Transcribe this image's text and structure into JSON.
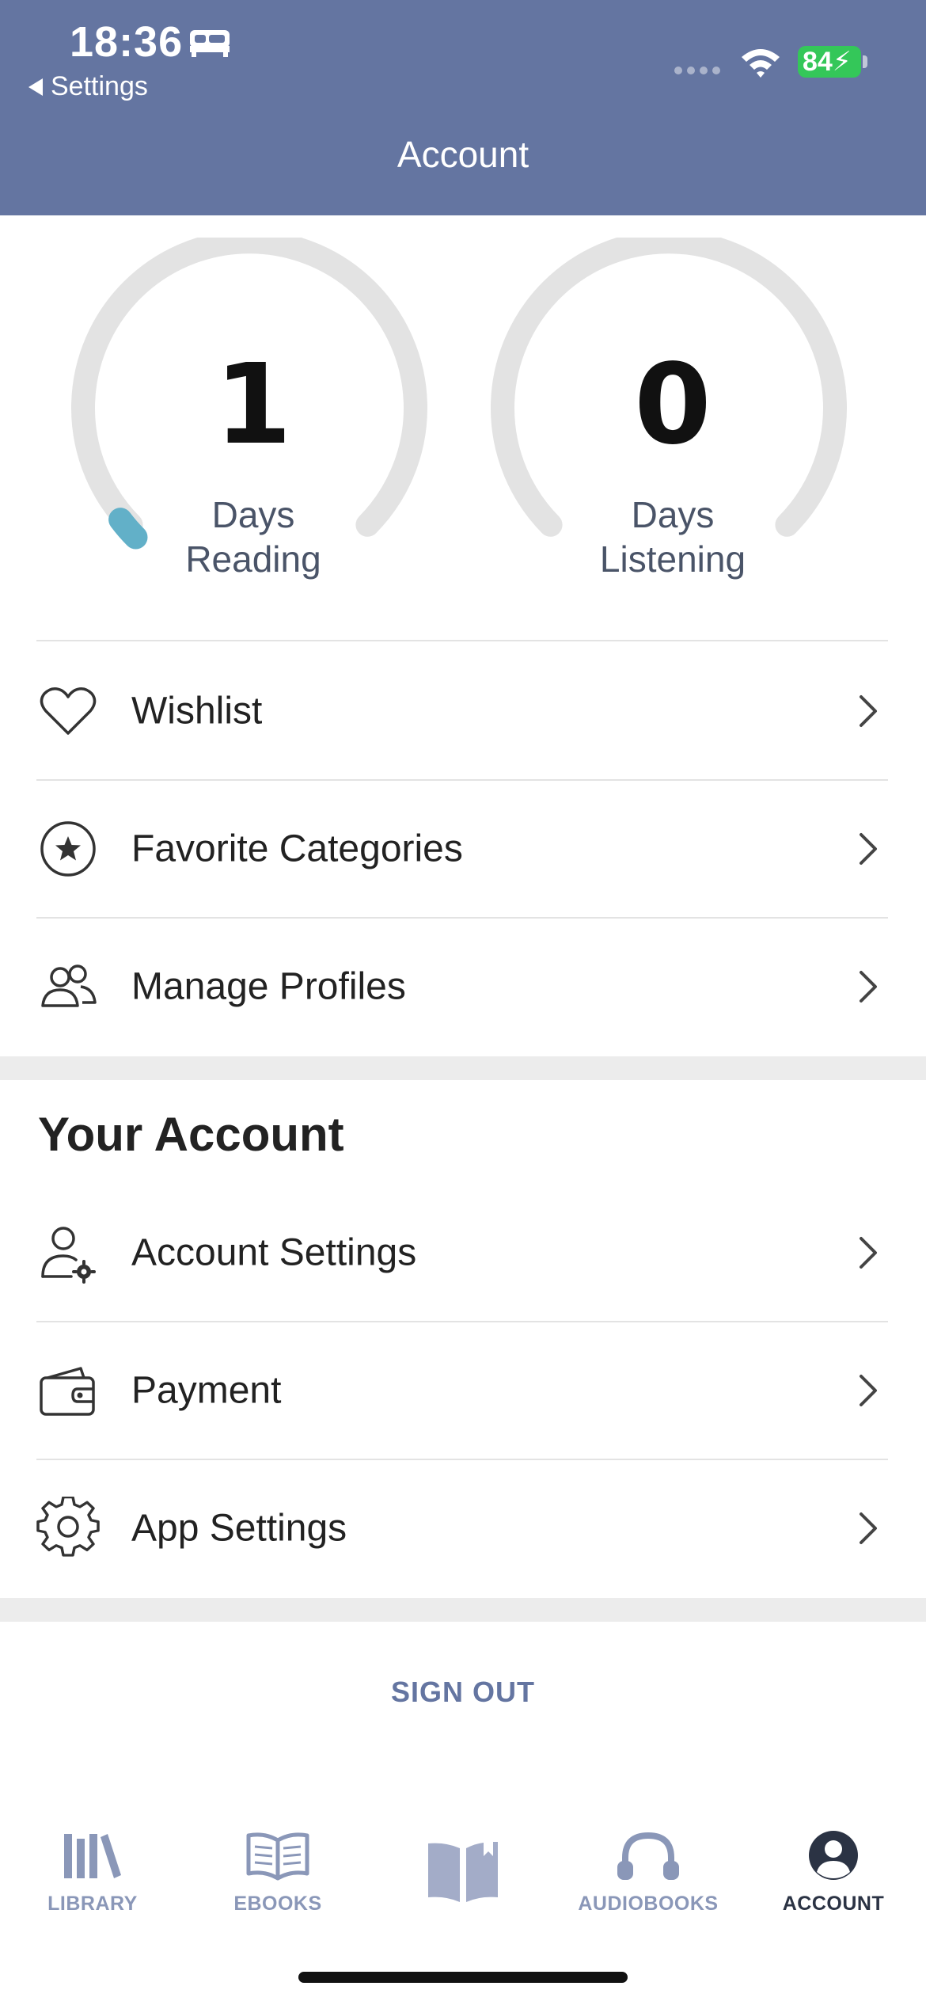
{
  "status_bar": {
    "time": "18:36",
    "back_label": "Settings",
    "battery": "84"
  },
  "header": {
    "title": "Account"
  },
  "stats": [
    {
      "value": "1",
      "label_line1": "Days",
      "label_line2": "Reading",
      "progress": 0.03
    },
    {
      "value": "0",
      "label_line1": "Days",
      "label_line2": "Listening",
      "progress": 0
    }
  ],
  "colors": {
    "accent": "#6475a1",
    "progress": "#62b0c8",
    "track": "#e3e3e3"
  },
  "quick_links": [
    {
      "label": "Wishlist",
      "icon": "heart-icon"
    },
    {
      "label": "Favorite Categories",
      "icon": "star-circle-icon"
    },
    {
      "label": "Manage Profiles",
      "icon": "users-icon"
    }
  ],
  "your_account": {
    "title": "Your Account",
    "items": [
      {
        "label": "Account Settings",
        "icon": "user-gear-icon"
      },
      {
        "label": "Payment",
        "icon": "wallet-icon"
      },
      {
        "label": "App Settings",
        "icon": "gear-icon"
      }
    ]
  },
  "sign_out": "SIGN OUT",
  "tabs": [
    {
      "label": "LIBRARY",
      "icon": "library-icon"
    },
    {
      "label": "EBOOKS",
      "icon": "ebook-icon"
    },
    {
      "label": "",
      "icon": "reading-icon"
    },
    {
      "label": "AUDIOBOOKS",
      "icon": "headphones-icon"
    },
    {
      "label": "ACCOUNT",
      "icon": "account-icon",
      "active": true
    }
  ]
}
